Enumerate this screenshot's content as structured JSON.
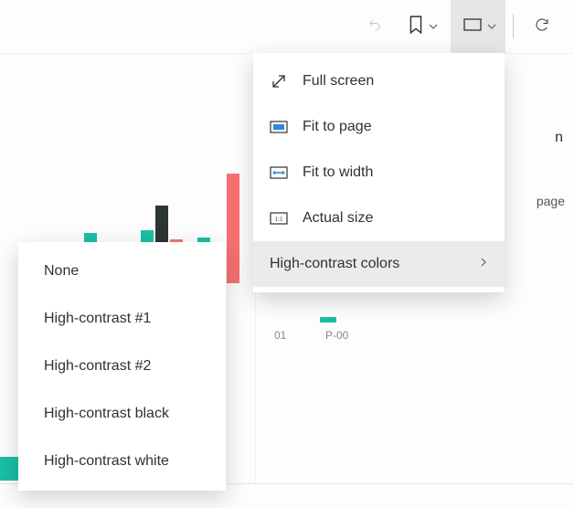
{
  "toolbar": {
    "undo_icon": "undo",
    "bookmark_icon": "bookmark",
    "view_icon": "view-rect",
    "refresh_icon": "refresh"
  },
  "view_menu": {
    "items": [
      {
        "icon": "fullscreen",
        "label": "Full screen"
      },
      {
        "icon": "fit-page",
        "label": "Fit to page"
      },
      {
        "icon": "fit-width",
        "label": "Fit to width"
      },
      {
        "icon": "actual",
        "label": "Actual size"
      }
    ],
    "submenu_label": "High-contrast colors"
  },
  "high_contrast_submenu": {
    "items": [
      "None",
      "High-contrast #1",
      "High-contrast #2",
      "High-contrast black",
      "High-contrast white"
    ]
  },
  "right_column": {
    "top_fragment": "n",
    "page_fragment": "page"
  },
  "chart_data": {
    "type": "bar",
    "categories": [
      "01",
      "P-00"
    ],
    "legend_color": "#1bbfa5",
    "series": [
      {
        "name": "teal",
        "color": "#1bbfa5",
        "values": [
          15,
          55,
          58,
          50,
          98,
          55
        ]
      },
      {
        "name": "dark",
        "color": "#2d3436",
        "values": [
          35,
          20,
          85,
          30,
          30,
          0
        ]
      },
      {
        "name": "red",
        "color": "#f87171",
        "values": [
          25,
          45,
          48,
          120,
          62,
          110
        ]
      }
    ],
    "note": "values are approximate pixel heights read from cropped chart; true units not visible"
  }
}
